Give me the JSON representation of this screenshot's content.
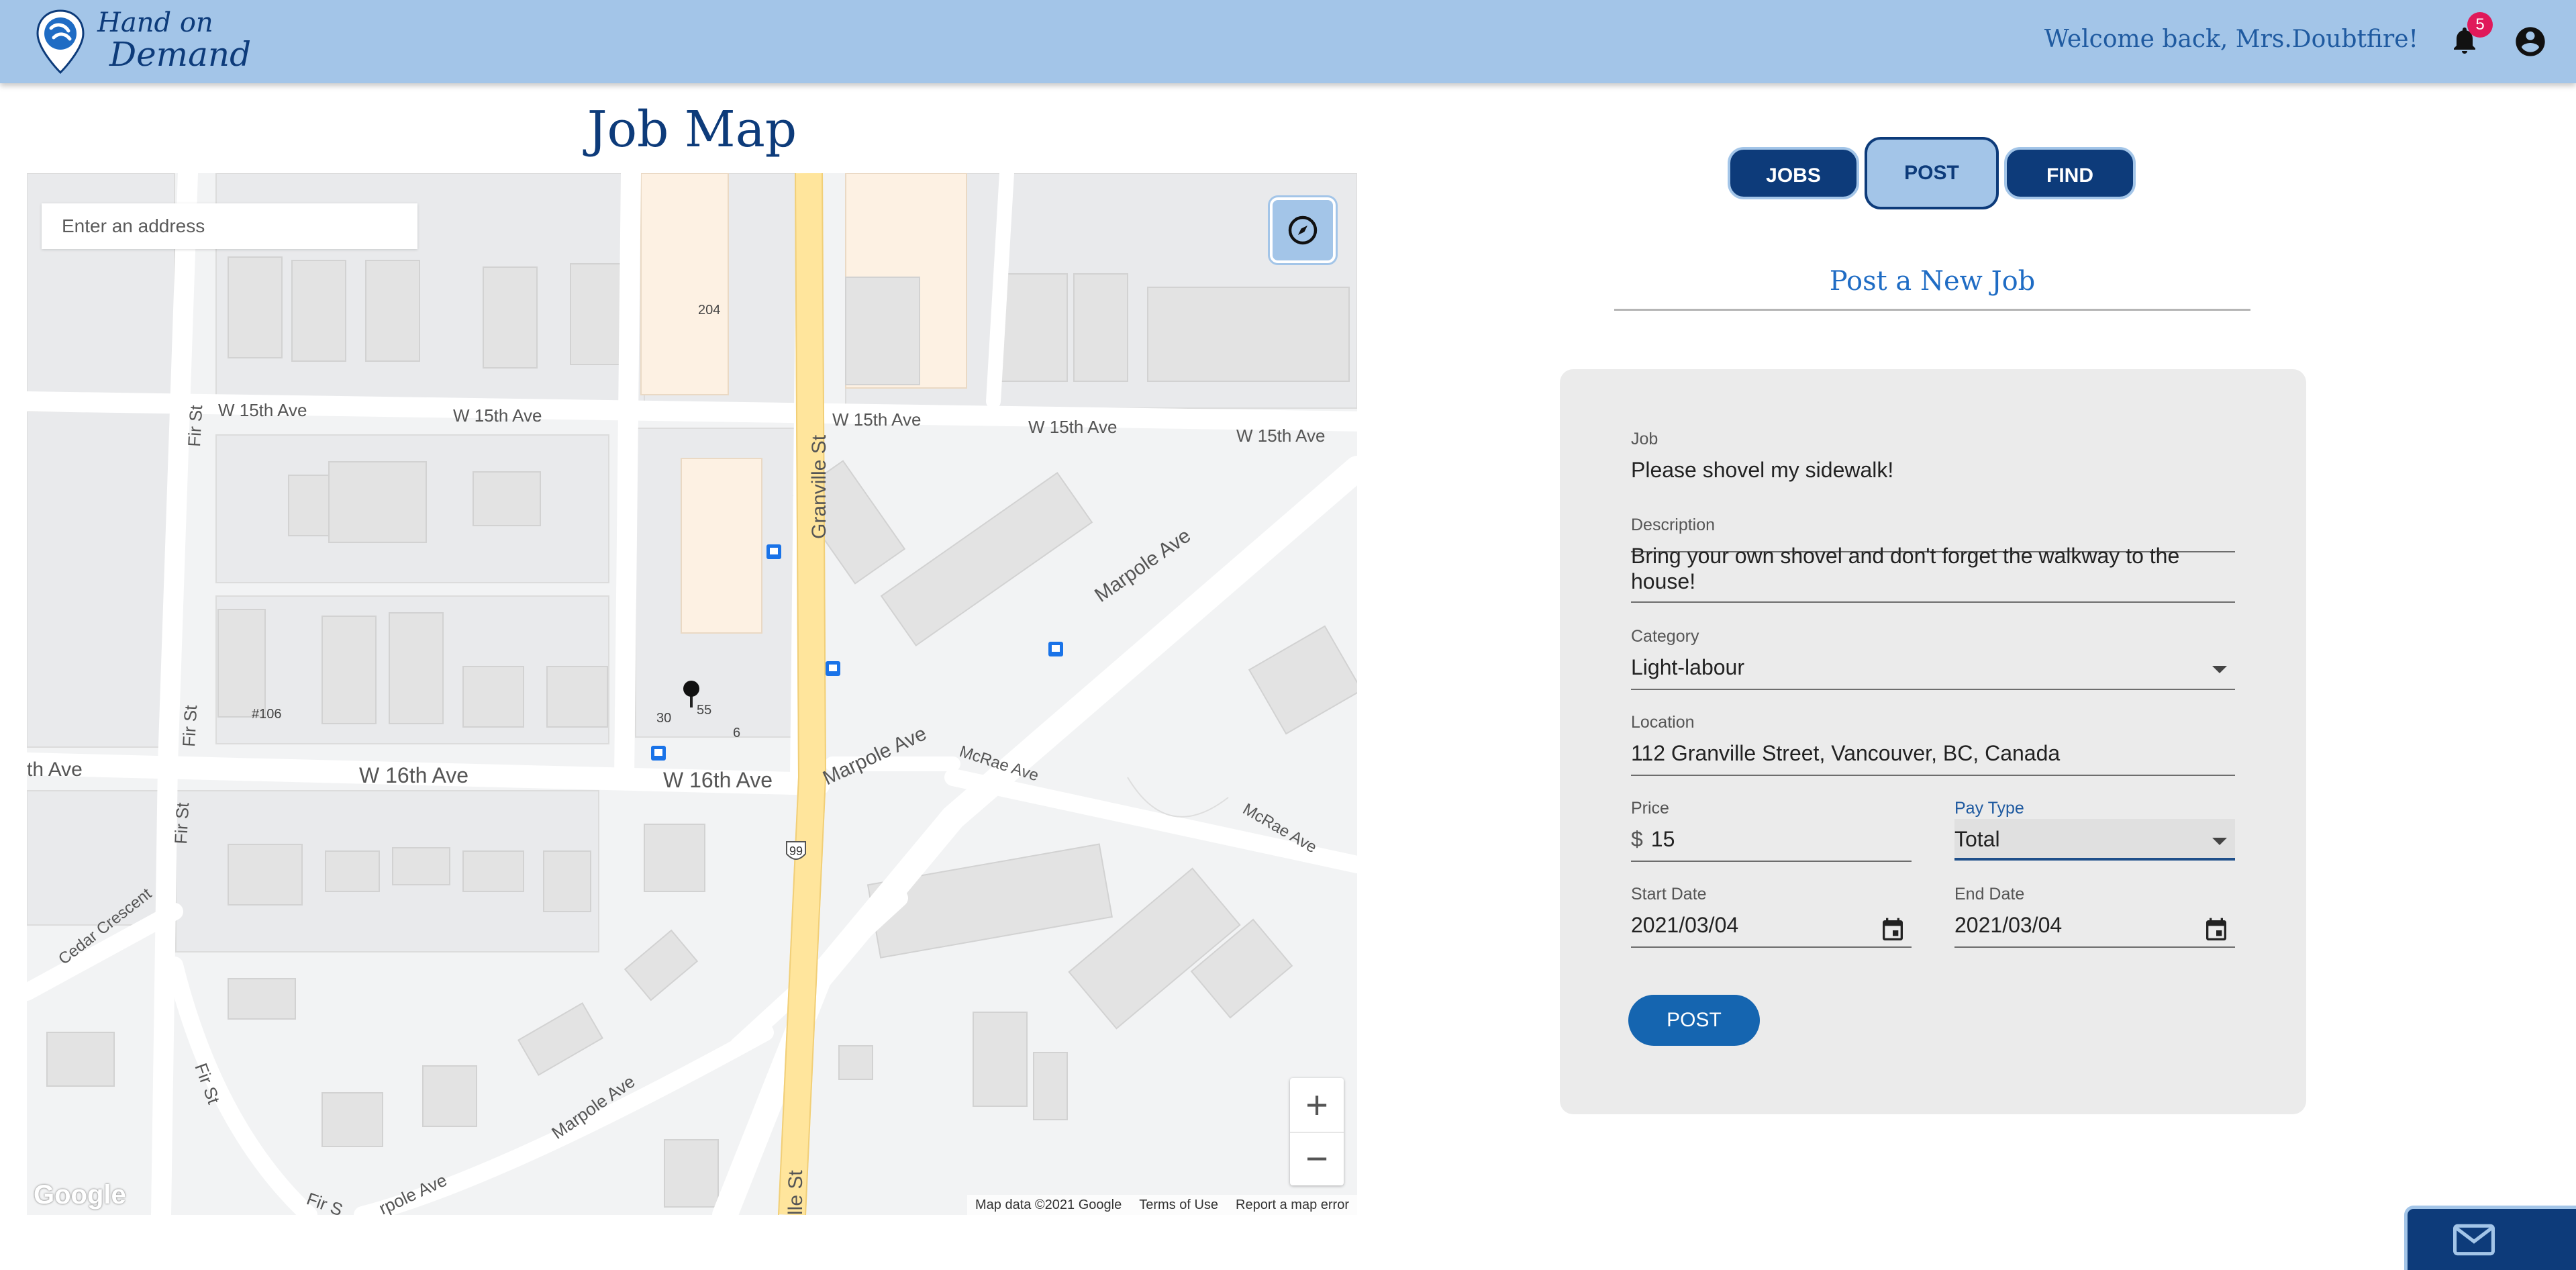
{
  "app": {
    "logo_line1": "Hand on",
    "logo_line2": "Demand",
    "welcome": "Welcome back, Mrs.Doubtfire!",
    "notification_count": "5",
    "colors": {
      "header": "#a3c5e8",
      "navy": "#0d3b7a",
      "accent_blue": "#1565b0",
      "badge": "#e0195a"
    }
  },
  "map": {
    "title": "Job Map",
    "address_placeholder": "Enter an address",
    "zoom_in": "+",
    "zoom_out": "−",
    "google": "Google",
    "footer": {
      "data": "Map data ©2021 Google",
      "terms": "Terms of Use",
      "report": "Report a map error"
    },
    "labels": {
      "w15_a": "W 15th Ave",
      "w15_b": "W 15th Ave",
      "w15_c": "W 15th Ave",
      "w15_d": "W 15th Ave",
      "w15_e": "W 15th Ave",
      "w16_a": "th Ave",
      "w16_b": "W 16th Ave",
      "w16_c": "W 16th Ave",
      "fir_a": "Fir St",
      "fir_b": "Fir St",
      "fir_c": "Fir St",
      "fir_d": "Fir St",
      "fir_e": "Fir S",
      "granville": "Granville St",
      "granville_bottom": "lle St",
      "marpole_a": "Marpole Ave",
      "marpole_b": "Marpole Ave",
      "marpole_c": "Marpole Ave",
      "marpole_d": "rpole Ave",
      "mcrae_a": "McRae Ave",
      "mcrae_b": "McRae Ave",
      "cedar": "Cedar Crescent",
      "num_204": "204",
      "num_106": "#106",
      "num_30": "30",
      "num_55": "55",
      "num_6": "6",
      "hwy": "99"
    }
  },
  "tabs": {
    "jobs": "JOBS",
    "post": "POST",
    "find": "FIND",
    "active": "POST"
  },
  "form": {
    "title": "Post a New Job",
    "job": {
      "label": "Job",
      "value": "Please shovel my sidewalk!"
    },
    "description": {
      "label": "Description",
      "value": "Bring your own shovel and don't forget the walkway to the house!"
    },
    "category": {
      "label": "Category",
      "value": "Light-labour"
    },
    "location": {
      "label": "Location",
      "value": "112 Granville Street, Vancouver, BC, Canada"
    },
    "price": {
      "label": "Price",
      "prefix": "$",
      "value": "15"
    },
    "pay_type": {
      "label": "Pay Type",
      "value": "Total"
    },
    "start_date": {
      "label": "Start Date",
      "value": "2021/03/04"
    },
    "end_date": {
      "label": "End Date",
      "value": "2021/03/04"
    },
    "submit": "POST"
  },
  "icons": [
    "logo-pin-icon",
    "bell-icon",
    "account-icon",
    "compass-icon",
    "calendar-icon",
    "dropdown-caret-icon",
    "mail-icon",
    "map-pin-icon",
    "bus-stop-icon"
  ]
}
